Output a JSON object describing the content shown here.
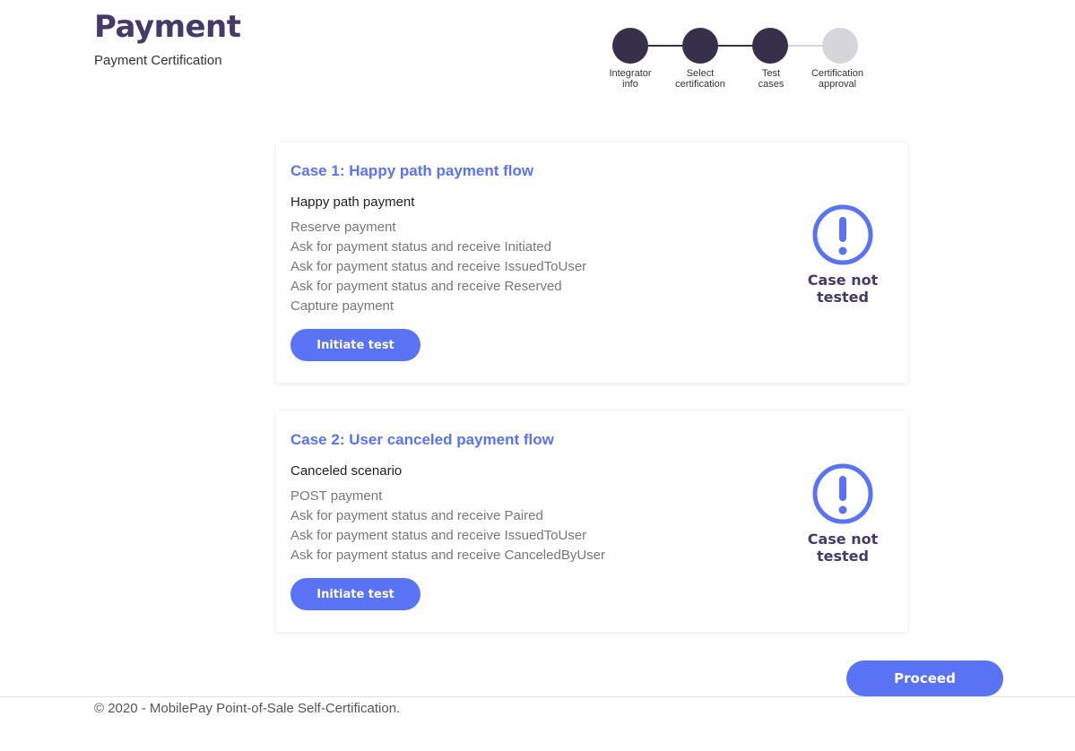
{
  "header": {
    "title": "Payment",
    "subtitle": "Payment Certification"
  },
  "stepper": {
    "steps": [
      {
        "line1": "Integrator",
        "line2": "info",
        "status": "complete"
      },
      {
        "line1": "Select",
        "line2": "certification",
        "status": "complete"
      },
      {
        "line1": "Test",
        "line2": "cases",
        "status": "current"
      },
      {
        "line1": "Certification",
        "line2": "approval",
        "status": "pending"
      }
    ],
    "colors": {
      "complete": "#37304a",
      "pending": "#d6d5da"
    }
  },
  "cases": [
    {
      "title": "Case 1: Happy path payment flow",
      "scenario": "Happy path payment",
      "steps": [
        "Reserve payment",
        "Ask for payment status and receive Initiated",
        "Ask for payment status and receive IssuedToUser",
        "Ask for payment status and receive Reserved",
        "Capture payment"
      ],
      "button_label": "Initiate test",
      "status_line1": "Case not",
      "status_line2": "tested",
      "status_icon": "exclamation-circle-icon"
    },
    {
      "title": "Case 2: User canceled payment flow",
      "scenario": "Canceled scenario",
      "steps": [
        "POST payment",
        "Ask for payment status and receive Paired",
        "Ask for payment status and receive IssuedToUser",
        "Ask for payment status and receive CanceledByUser"
      ],
      "button_label": "Initiate test",
      "status_line1": "Case not",
      "status_line2": "tested",
      "status_icon": "exclamation-circle-icon"
    }
  ],
  "actions": {
    "proceed_label": "Proceed"
  },
  "footer": {
    "text": "© 2020 - MobilePay Point-of-Sale Self-Certification."
  },
  "colors": {
    "accent": "#5a73f5",
    "title": "#463a66"
  }
}
